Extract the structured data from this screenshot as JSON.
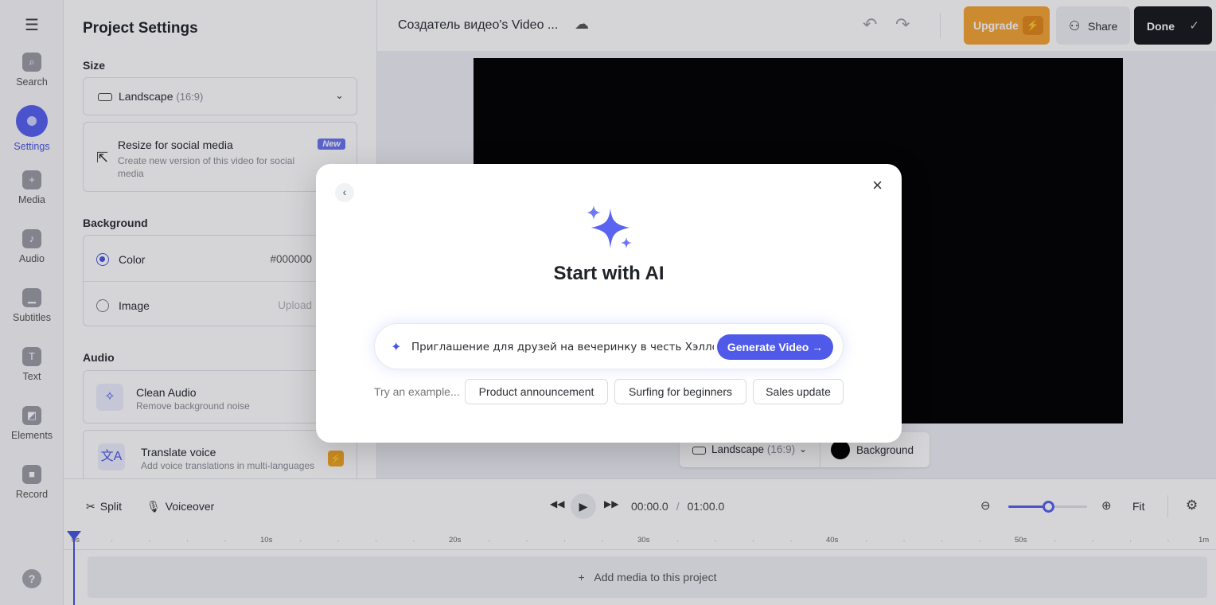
{
  "rail": {
    "items": [
      {
        "label": "Search"
      },
      {
        "label": "Settings"
      },
      {
        "label": "Media"
      },
      {
        "label": "Audio"
      },
      {
        "label": "Subtitles"
      },
      {
        "label": "Text"
      },
      {
        "label": "Elements"
      },
      {
        "label": "Record"
      }
    ],
    "help": "?"
  },
  "panel": {
    "title": "Project Settings",
    "size_label": "Size",
    "size_value": "Landscape",
    "size_ratio": "(16:9)",
    "resize_title": "Resize for social media",
    "resize_desc": "Create new version of this video for social media",
    "resize_badge": "New",
    "background_label": "Background",
    "bg_color_label": "Color",
    "bg_color_value": "#000000",
    "bg_image_label": "Image",
    "bg_image_action": "Upload",
    "audio_label": "Audio",
    "clean_audio_title": "Clean Audio",
    "clean_audio_desc": "Remove background noise",
    "translate_title": "Translate voice",
    "translate_desc": "Add voice translations in multi-languages"
  },
  "topbar": {
    "project_title": "Создатель видео's Video ...",
    "upgrade": "Upgrade",
    "share": "Share",
    "done": "Done"
  },
  "canvas": {
    "ratio_label": "Landscape",
    "ratio_value": "(16:9)",
    "background_label": "Background"
  },
  "timeline": {
    "split": "Split",
    "voiceover": "Voiceover",
    "current_time": "00:00.0",
    "total_time": "01:00.0",
    "zoom_level": 0.5,
    "fit": "Fit",
    "ruler": [
      "0s",
      "10s",
      "20s",
      "30s",
      "40s",
      "50s",
      "1m"
    ],
    "add_media": "Add media to this project"
  },
  "modal": {
    "title": "Start with AI",
    "prompt_value": "Приглашение для друзей на вечеринку в честь Хэллоуина",
    "generate": "Generate Video →",
    "try_label": "Try an example...",
    "examples": [
      "Product announcement",
      "Surfing for beginners",
      "Sales update"
    ]
  },
  "colors": {
    "accent": "#5661f0",
    "upgrade": "#f6a534",
    "done": "#17191c"
  }
}
